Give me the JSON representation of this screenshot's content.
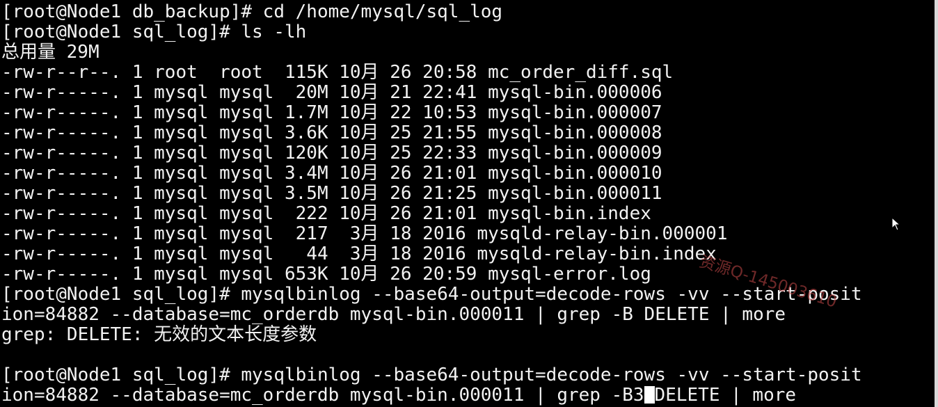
{
  "terminal": {
    "lines": [
      "[root@Node1 db_backup]# cd /home/mysql/sql_log",
      "[root@Node1 sql_log]# ls -lh",
      "总用量 29M",
      "-rw-r--r--. 1 root  root  115K 10月 26 20:58 mc_order_diff.sql",
      "-rw-r-----. 1 mysql mysql  20M 10月 21 22:41 mysql-bin.000006",
      "-rw-r-----. 1 mysql mysql 1.7M 10月 22 10:53 mysql-bin.000007",
      "-rw-r-----. 1 mysql mysql 3.6K 10月 25 21:55 mysql-bin.000008",
      "-rw-r-----. 1 mysql mysql 120K 10月 25 22:33 mysql-bin.000009",
      "-rw-r-----. 1 mysql mysql 3.4M 10月 26 21:01 mysql-bin.000010",
      "-rw-r-----. 1 mysql mysql 3.5M 10月 26 21:25 mysql-bin.000011",
      "-rw-r-----. 1 mysql mysql  222 10月 26 21:01 mysql-bin.index",
      "-rw-r-----. 1 mysql mysql  217  3月 18 2016 mysqld-relay-bin.000001",
      "-rw-r-----. 1 mysql mysql   44  3月 18 2016 mysqld-relay-bin.index",
      "-rw-r-----. 1 mysql mysql 653K 10月 26 20:59 mysql-error.log",
      "[root@Node1 sql_log]# mysqlbinlog --base64-output=decode-rows -vv --start-posit",
      "ion=84882 --database=mc_orderdb mysql-bin.000011 | grep -B DELETE | more",
      "grep: DELETE: 无效的文本长度参数",
      "",
      "[root@Node1 sql_log]# mysqlbinlog --base64-output=decode-rows -vv --start-posit"
    ],
    "last_line_before_cursor": "ion=84882 --database=mc_orderdb mysql-bin.000011 | grep -B3",
    "last_line_after_cursor": "DELETE | more"
  },
  "watermark": {
    "text": "资源Q-145003610"
  },
  "icons": {
    "mouse_pointer": "arrow-pointer-icon"
  }
}
